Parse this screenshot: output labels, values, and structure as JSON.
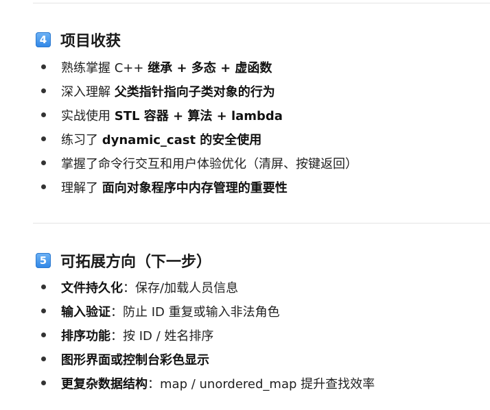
{
  "section4": {
    "number": "4",
    "title": "项目收获",
    "items": [
      {
        "parts": [
          {
            "t": "熟练掌握 C++ ",
            "b": false
          },
          {
            "t": "继承 + 多态 + 虚函数",
            "b": true
          }
        ]
      },
      {
        "parts": [
          {
            "t": "深入理解 ",
            "b": false
          },
          {
            "t": "父类指针指向子类对象的行为",
            "b": true
          }
        ]
      },
      {
        "parts": [
          {
            "t": "实战使用 ",
            "b": false
          },
          {
            "t": "STL 容器 + 算法 + lambda",
            "b": true
          }
        ]
      },
      {
        "parts": [
          {
            "t": "练习了 ",
            "b": false
          },
          {
            "t": "dynamic_cast 的安全使用",
            "b": true
          }
        ]
      },
      {
        "parts": [
          {
            "t": "掌握了命令行交互和用户体验优化（清屏、按键返回）",
            "b": false
          }
        ]
      },
      {
        "parts": [
          {
            "t": "理解了 ",
            "b": false
          },
          {
            "t": "面向对象程序中内存管理的重要性",
            "b": true
          }
        ]
      }
    ]
  },
  "section5": {
    "number": "5",
    "title": "可拓展方向（下一步）",
    "items": [
      {
        "parts": [
          {
            "t": "文件持久化",
            "b": true
          },
          {
            "t": "：保存/加载人员信息",
            "b": false
          }
        ]
      },
      {
        "parts": [
          {
            "t": "输入验证",
            "b": true
          },
          {
            "t": "：防止 ID 重复或输入非法角色",
            "b": false
          }
        ]
      },
      {
        "parts": [
          {
            "t": "排序功能",
            "b": true
          },
          {
            "t": "：按 ID / 姓名排序",
            "b": false
          }
        ]
      },
      {
        "parts": [
          {
            "t": "图形界面或控制台彩色显示",
            "b": true
          }
        ]
      },
      {
        "parts": [
          {
            "t": "更复杂数据结构",
            "b": true
          },
          {
            "t": "：map / unordered_map 提升查找效率",
            "b": false
          }
        ]
      }
    ]
  },
  "colors": {
    "badge": "#2f86e6",
    "divider": "#e3e3e3",
    "text": "#1f1f1f"
  }
}
